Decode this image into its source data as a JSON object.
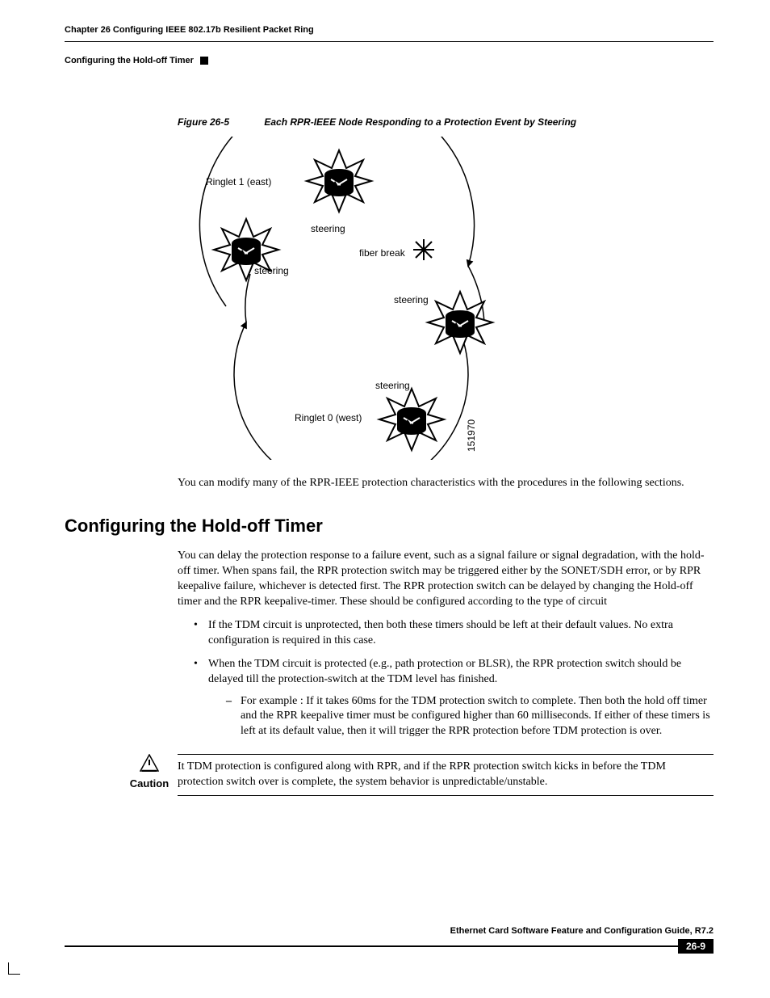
{
  "header": {
    "chapter_line": "Chapter 26 Configuring IEEE 802.17b Resilient Packet Ring",
    "section_line": "Configuring the Hold-off Timer"
  },
  "figure": {
    "number": "Figure 26-5",
    "title": "Each RPR-IEEE Node Responding to a Protection Event by Steering",
    "labels": {
      "ringlet1": "Ringlet 1 (east)",
      "ringlet0": "Ringlet 0 (west)",
      "steering_tl": "steering",
      "steering_l": "steering",
      "steering_r": "steering",
      "steering_b": "steering",
      "fiber_break": "fiber break",
      "art_id": "151970"
    }
  },
  "intro_para": "You can modify many of the RPR-IEEE protection characteristics with the procedures in the following sections.",
  "section": {
    "title": "Configuring the Hold-off Timer",
    "para1": "You can delay the protection response to a failure event, such as a signal failure or signal degradation, with the hold-off timer. When spans fail, the RPR protection switch may be triggered either by the SONET/SDH error, or by RPR keepalive failure, whichever is detected first. The RPR protection switch can be delayed by changing the Hold-off timer and the RPR keepalive-timer. These should be configured according to the type of circuit",
    "bullets": [
      "If the TDM circuit is unprotected, then both these timers should be left at their default values. No extra configuration is required in this case.",
      "When the TDM circuit is protected (e.g., path protection or BLSR), the RPR protection switch should be delayed till the protection-switch at the TDM level has finished."
    ],
    "dash": "For example : If it takes 60ms for the TDM protection switch to complete. Then both the hold off timer and the RPR keepalive timer must be configured higher than 60 milliseconds. If either of these timers is left at its default value, then it will trigger the RPR protection before TDM protection is over."
  },
  "caution": {
    "label": "Caution",
    "text": "It TDM protection is configured along with RPR, and if the RPR protection switch kicks in before the TDM protection switch over is complete, the system behavior is unpredictable/unstable."
  },
  "footer": {
    "doc_title": "Ethernet Card Software Feature and Configuration Guide, R7.2",
    "page": "26-9"
  }
}
